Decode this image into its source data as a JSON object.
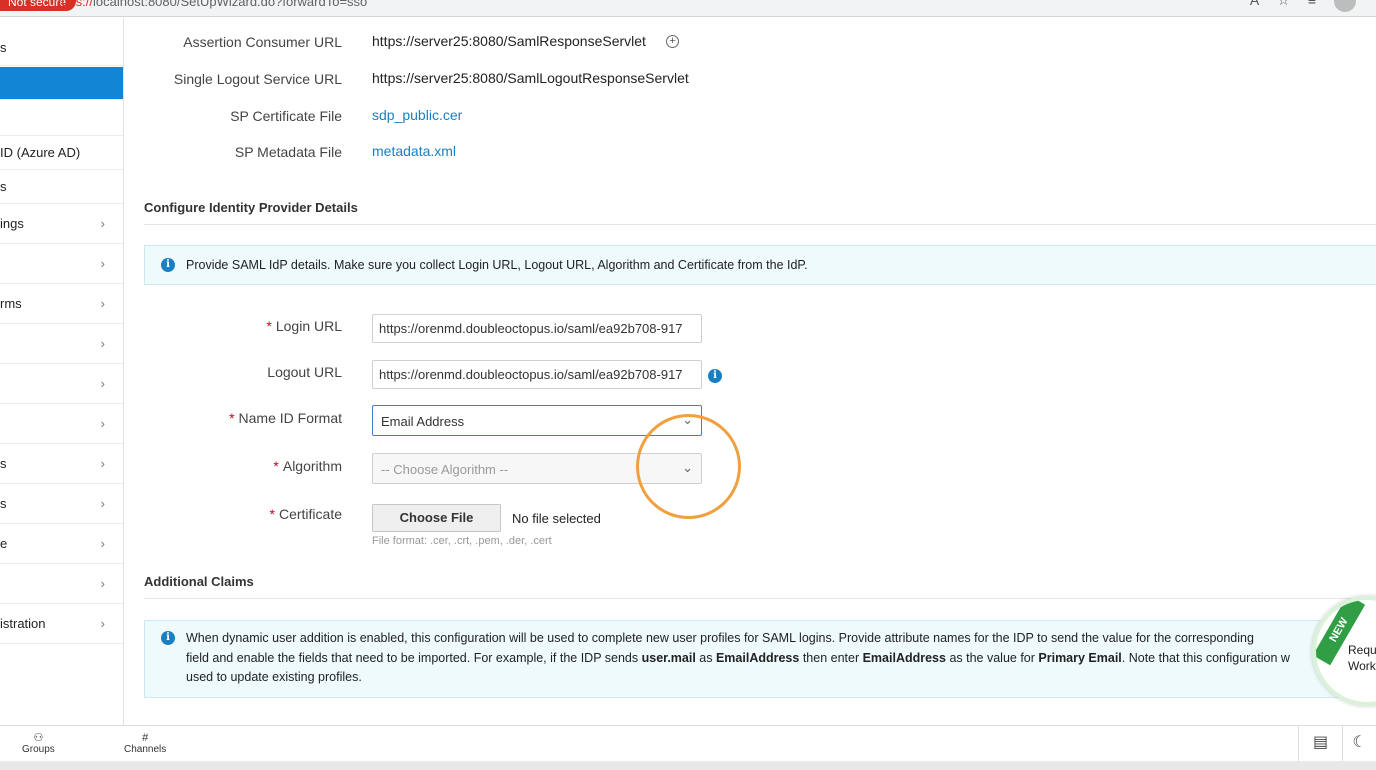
{
  "browser": {
    "security": "Not secure",
    "url_prefix": "https://",
    "url_rest": "localhost:8080/SetUpWizard.do?forwardTo=sso"
  },
  "sidebar": {
    "items": [
      {
        "label": "s",
        "has_chevron": false,
        "active": false
      },
      {
        "label": "",
        "has_chevron": false,
        "active": true
      },
      {
        "label": "",
        "has_chevron": false,
        "active": false
      },
      {
        "label": "ID (Azure AD)",
        "has_chevron": false,
        "active": false
      },
      {
        "label": "s",
        "has_chevron": false,
        "active": false
      },
      {
        "label": "ings",
        "has_chevron": true,
        "active": false
      },
      {
        "label": "",
        "has_chevron": true,
        "active": false
      },
      {
        "label": "rms",
        "has_chevron": true,
        "active": false
      },
      {
        "label": "",
        "has_chevron": true,
        "active": false
      },
      {
        "label": "",
        "has_chevron": true,
        "active": false
      },
      {
        "label": "",
        "has_chevron": true,
        "active": false
      },
      {
        "label": "s",
        "has_chevron": true,
        "active": false
      },
      {
        "label": "s",
        "has_chevron": true,
        "active": false
      },
      {
        "label": "e",
        "has_chevron": true,
        "active": false
      },
      {
        "label": "",
        "has_chevron": true,
        "active": false
      },
      {
        "label": "istration",
        "has_chevron": true,
        "active": false
      }
    ],
    "chevron_glyph": "›"
  },
  "sp_details": {
    "acs_label": "Assertion Consumer URL",
    "acs_value": "https://server25:8080/SamlResponseServlet",
    "slo_label": "Single Logout Service URL",
    "slo_value": "https://server25:8080/SamlLogoutResponseServlet",
    "cert_label": "SP Certificate File",
    "cert_value": "sdp_public.cer",
    "metadata_label": "SP Metadata File",
    "metadata_value": "metadata.xml"
  },
  "idp": {
    "section_title": "Configure Identity Provider Details",
    "info": "Provide SAML IdP details. Make sure you collect Login URL, Logout URL, Algorithm and Certificate from the IdP.",
    "login_label": "Login URL",
    "login_value": "https://orenmd.doubleoctopus.io/saml/ea92b708-917",
    "logout_label": "Logout URL",
    "logout_value": "https://orenmd.doubleoctopus.io/saml/ea92b708-917",
    "nameid_label": "Name ID Format",
    "nameid_value": "Email Address",
    "algorithm_label": "Algorithm",
    "algorithm_placeholder": "-- Choose Algorithm --",
    "certificate_label": "Certificate",
    "choose_file": "Choose File",
    "no_file": "No file selected",
    "file_hint": "File format: .cer, .crt, .pem, .der, .cert",
    "required_mark": "*"
  },
  "claims": {
    "section_title": "Additional Claims",
    "line1": "When dynamic user addition is enabled, this configuration will be used to complete new user profiles for SAML logins. Provide attribute names for the IDP to send the value for the corresponding",
    "line2_a": "field and enable the fields that need to be imported. For example, if the IDP sends ",
    "line2_b": "user.mail",
    "line2_c": " as ",
    "line2_d": "EmailAddress",
    "line2_e": " then enter ",
    "line2_f": "EmailAddress",
    "line2_g": " as the value for ",
    "line2_h": "Primary Email",
    "line2_i": ". Note that this configuration w",
    "line3": "used to update existing profiles."
  },
  "new_badge": {
    "ribbon": "NEW",
    "text1": "Reque",
    "text2": "Workfl"
  },
  "bottom": {
    "groups": "Groups",
    "channels": "Channels"
  },
  "colors": {
    "accent": "#1286d5",
    "link": "#1a7fc1",
    "required": "#d0021b",
    "highlight_circle": "#f0a040"
  }
}
